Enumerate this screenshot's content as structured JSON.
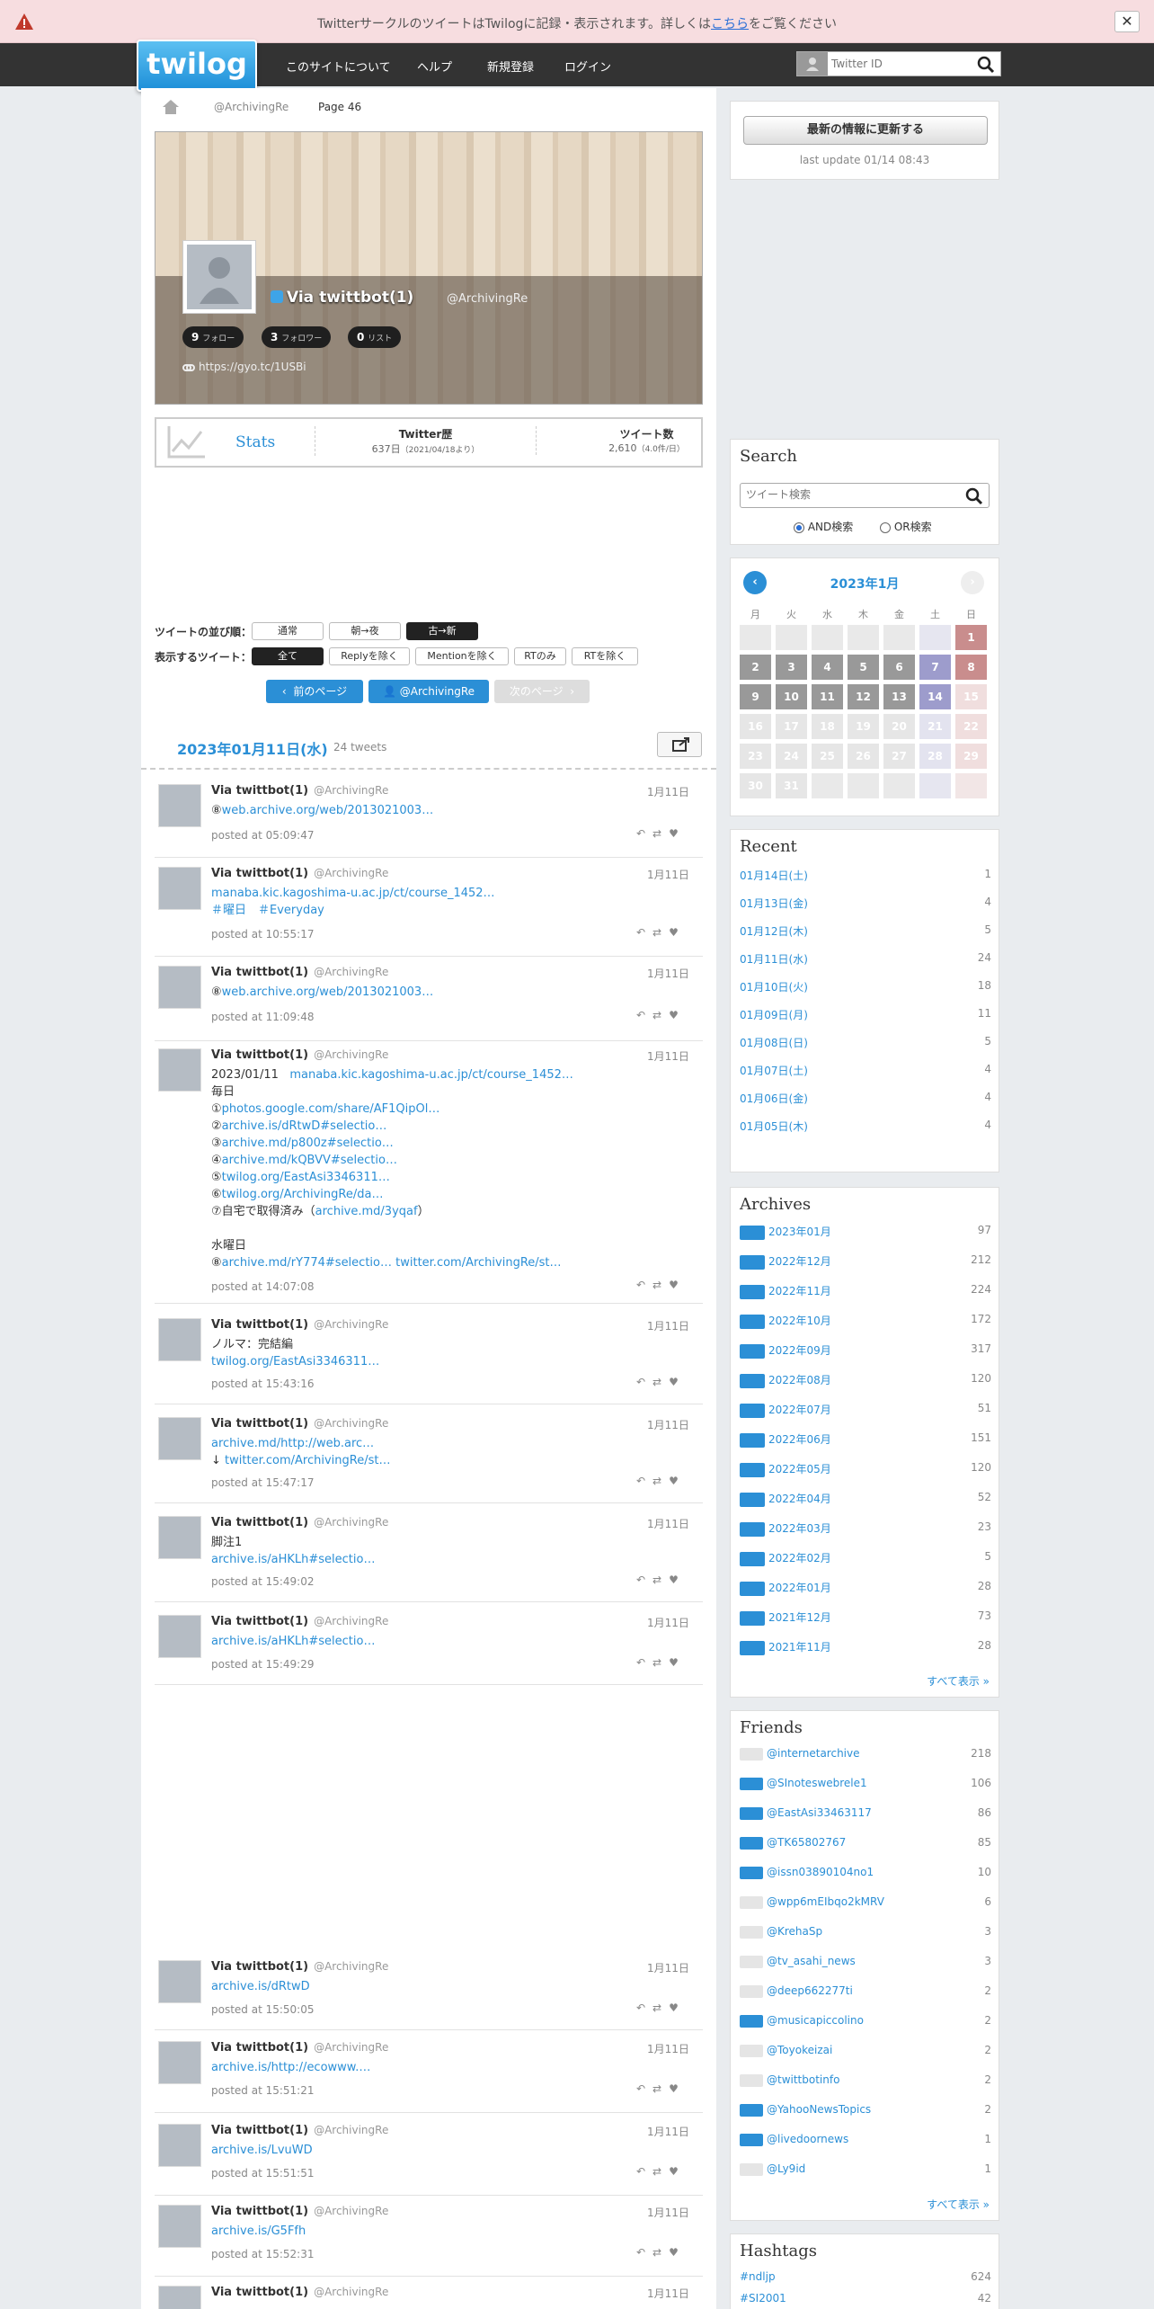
{
  "notice": {
    "before": "Twitterサークルのツイートは",
    "mid": "Twilogに記録・表示されます。詳しくは",
    "link": "こちら",
    "after": "をご覧ください",
    "close": "✕"
  },
  "nav": {
    "logo": "twilog",
    "about": "このサイトについて",
    "help": "ヘルプ",
    "register": "新規登録",
    "login": "ログイン",
    "search_placeholder": "Twitter ID"
  },
  "breadcrumb": {
    "user": "@ArchivingRe",
    "page": "Page 46"
  },
  "profile": {
    "name": "Via twittbot(1)",
    "screen_name": "@ArchivingRe",
    "follow": "9",
    "follow_label": "フォロー",
    "follower": "3",
    "follower_label": "フォロワー",
    "list": "0",
    "list_label": "リスト",
    "url": "https://gyo.tc/1USBi"
  },
  "stats": {
    "title": "Stats",
    "h1": "Twitter歴",
    "v1": "637日",
    "s1": "（2021/04/18より）",
    "h2": "ツイート数",
    "v2": "2,610",
    "s2": "（4.0件/日）"
  },
  "options": {
    "order_label": "ツイートの並び順：",
    "o1": "通常",
    "o2": "朝→夜",
    "o3": "古→新",
    "show_label": "表示するツイート：",
    "s1": "全て",
    "s2": "Replyを除く",
    "s3": "Mentionを除く",
    "s4": "RTのみ",
    "s5": "RTを除く"
  },
  "paging": {
    "prev": "前のページ",
    "user": "@ArchivingRe",
    "next": "次のページ"
  },
  "day": {
    "date": "2023年01月11日(水)",
    "count": "24 tweets"
  },
  "tweets": [
    {
      "name": "Via twittbot(1)",
      "sn": "@ArchivingRe",
      "date": "1月11日",
      "lines": [
        [
          "⑧",
          ""
        ],
        [
          "",
          "web.archive.org/web/2013021003…"
        ]
      ],
      "time": "posted at 05:09:47"
    },
    {
      "name": "Via twittbot(1)",
      "sn": "@ArchivingRe",
      "date": "1月11日",
      "lines": [
        [
          "",
          "manaba.kic.kagoshima-u.ac.jp/ct/course_1452…"
        ],
        [
          "",
          "＃曜日　＃Everyday"
        ]
      ],
      "time": "posted at 10:55:17"
    },
    {
      "name": "Via twittbot(1)",
      "sn": "@ArchivingRe",
      "date": "1月11日",
      "lines": [
        [
          "⑧",
          ""
        ],
        [
          "",
          "web.archive.org/web/2013021003…"
        ]
      ],
      "time": "posted at 11:09:48"
    },
    {
      "name": "Via twittbot(1)",
      "sn": "@ArchivingRe",
      "date": "1月11日",
      "time": "posted at 14:07:08"
    },
    {
      "name": "Via twittbot(1)",
      "sn": "@ArchivingRe",
      "date": "1月11日",
      "time": "posted at 15:43:16"
    },
    {
      "name": "Via twittbot(1)",
      "sn": "@ArchivingRe",
      "date": "1月11日",
      "time": "posted at 15:47:17"
    },
    {
      "name": "Via twittbot(1)",
      "sn": "@ArchivingRe",
      "date": "1月11日",
      "time": "posted at 15:49:02"
    },
    {
      "name": "Via twittbot(1)",
      "sn": "@ArchivingRe",
      "date": "1月11日",
      "time": "posted at 15:49:29"
    },
    {
      "name": "Via twittbot(1)",
      "sn": "@ArchivingRe",
      "date": "1月11日",
      "time": "posted at 15:50:05"
    },
    {
      "name": "Via twittbot(1)",
      "sn": "@ArchivingRe",
      "date": "1月11日",
      "time": "posted at 15:51:21"
    },
    {
      "name": "Via twittbot(1)",
      "sn": "@ArchivingRe",
      "date": "1月11日",
      "time": "posted at 15:51:51"
    },
    {
      "name": "Via twittbot(1)",
      "sn": "@ArchivingRe",
      "date": "1月11日",
      "time": "posted at 15:52:31"
    },
    {
      "name": "Via twittbot(1)",
      "sn": "@ArchivingRe",
      "date": "1月11日"
    }
  ],
  "t4": {
    "a": "2023/01/11",
    "a_link": "manaba.kic.kagoshima-u.ac.jp/ct/course_1452…",
    "b": "毎日",
    "c1": "①",
    "c1l": "photos.google.com/share/AF1QipOl…",
    "c2": "②",
    "c2l": "archive.is/dRtwD#selectio…",
    "c3": "③",
    "c3l": "archive.md/p800z#selectio…",
    "c4": "④",
    "c4l": "archive.md/kQBVV#selectio…",
    "c5": "⑤",
    "c5l": "twilog.org/EastAsi3346311…",
    "c6": "⑥",
    "c6l": "twilog.org/ArchivingRe/da…",
    "c7": "⑦自宅で取得済み（",
    "c7l": "archive.md/3yqaf",
    "c7e": "）",
    "d": "水曜日",
    "e": "⑧",
    "el": "archive.md/rY774#selectio…",
    "el2": "twitter.com/ArchivingRe/st…"
  },
  "t5": {
    "a": "ノルマ：完結編",
    "al": "twilog.org/EastAsi3346311…"
  },
  "t6": {
    "al": "archive.md/http://web.arc…",
    "b": "↓",
    "bl": "twitter.com/ArchivingRe/st…"
  },
  "t7": {
    "a": "脚注1",
    "al": "archive.is/aHKLh#selectio…"
  },
  "t8": {
    "al": "archive.is/aHKLh#selectio…"
  },
  "t9": {
    "al": "archive.is/dRtwD"
  },
  "t10": {
    "al": "archive.is/http://ecowww.…"
  },
  "t11": {
    "al": "archive.is/LvuWD"
  },
  "t12": {
    "al": "archive.is/G5Ffh"
  },
  "side": {
    "update_btn": "最新の情報に更新する",
    "last_update": "last update 01/14 08:43",
    "search_title": "Search",
    "search_placeholder": "ツイート検索",
    "and": "AND検索",
    "or": "OR検索",
    "cal_title": "2023年1月",
    "weekdays": [
      "月",
      "火",
      "水",
      "木",
      "金",
      "土",
      "日"
    ],
    "recent_title": "Recent",
    "recent": [
      [
        "01月14日(土)",
        "1"
      ],
      [
        "01月13日(金)",
        "4"
      ],
      [
        "01月12日(木)",
        "5"
      ],
      [
        "01月11日(水)",
        "24"
      ],
      [
        "01月10日(火)",
        "18"
      ],
      [
        "01月09日(月)",
        "11"
      ],
      [
        "01月08日(日)",
        "5"
      ],
      [
        "01月07日(土)",
        "4"
      ],
      [
        "01月06日(金)",
        "4"
      ],
      [
        "01月05日(木)",
        "4"
      ]
    ],
    "archives_title": "Archives",
    "archives": [
      [
        "2023年01月",
        "97"
      ],
      [
        "2022年12月",
        "212"
      ],
      [
        "2022年11月",
        "224"
      ],
      [
        "2022年10月",
        "172"
      ],
      [
        "2022年09月",
        "317"
      ],
      [
        "2022年08月",
        "120"
      ],
      [
        "2022年07月",
        "51"
      ],
      [
        "2022年06月",
        "151"
      ],
      [
        "2022年05月",
        "120"
      ],
      [
        "2022年04月",
        "52"
      ],
      [
        "2022年03月",
        "23"
      ],
      [
        "2022年02月",
        "5"
      ],
      [
        "2022年01月",
        "28"
      ],
      [
        "2021年12月",
        "73"
      ],
      [
        "2021年11月",
        "28"
      ]
    ],
    "show_all": "すべて表示 »",
    "friends_title": "Friends",
    "friends": [
      [
        "@internetarchive",
        "218"
      ],
      [
        "@SInoteswebrele1",
        "106"
      ],
      [
        "@EastAsi33463117",
        "86"
      ],
      [
        "@TK65802767",
        "85"
      ],
      [
        "@issn03890104no1",
        "10"
      ],
      [
        "@wpp6mEIbqo2kMRV",
        "6"
      ],
      [
        "@KrehaSp",
        "3"
      ],
      [
        "@tv_asahi_news",
        "3"
      ],
      [
        "@deep662277ti",
        "2"
      ],
      [
        "@musicapiccolino",
        "2"
      ],
      [
        "@Toyokeizai",
        "2"
      ],
      [
        "@twittbotinfo",
        "2"
      ],
      [
        "@YahooNewsTopics",
        "2"
      ],
      [
        "@livedoornews",
        "1"
      ],
      [
        "@Ly9id",
        "1"
      ]
    ],
    "hashtags_title": "Hashtags",
    "hashtags": [
      [
        "#ndljp",
        "624"
      ],
      [
        "#SI2001",
        "42"
      ]
    ]
  }
}
